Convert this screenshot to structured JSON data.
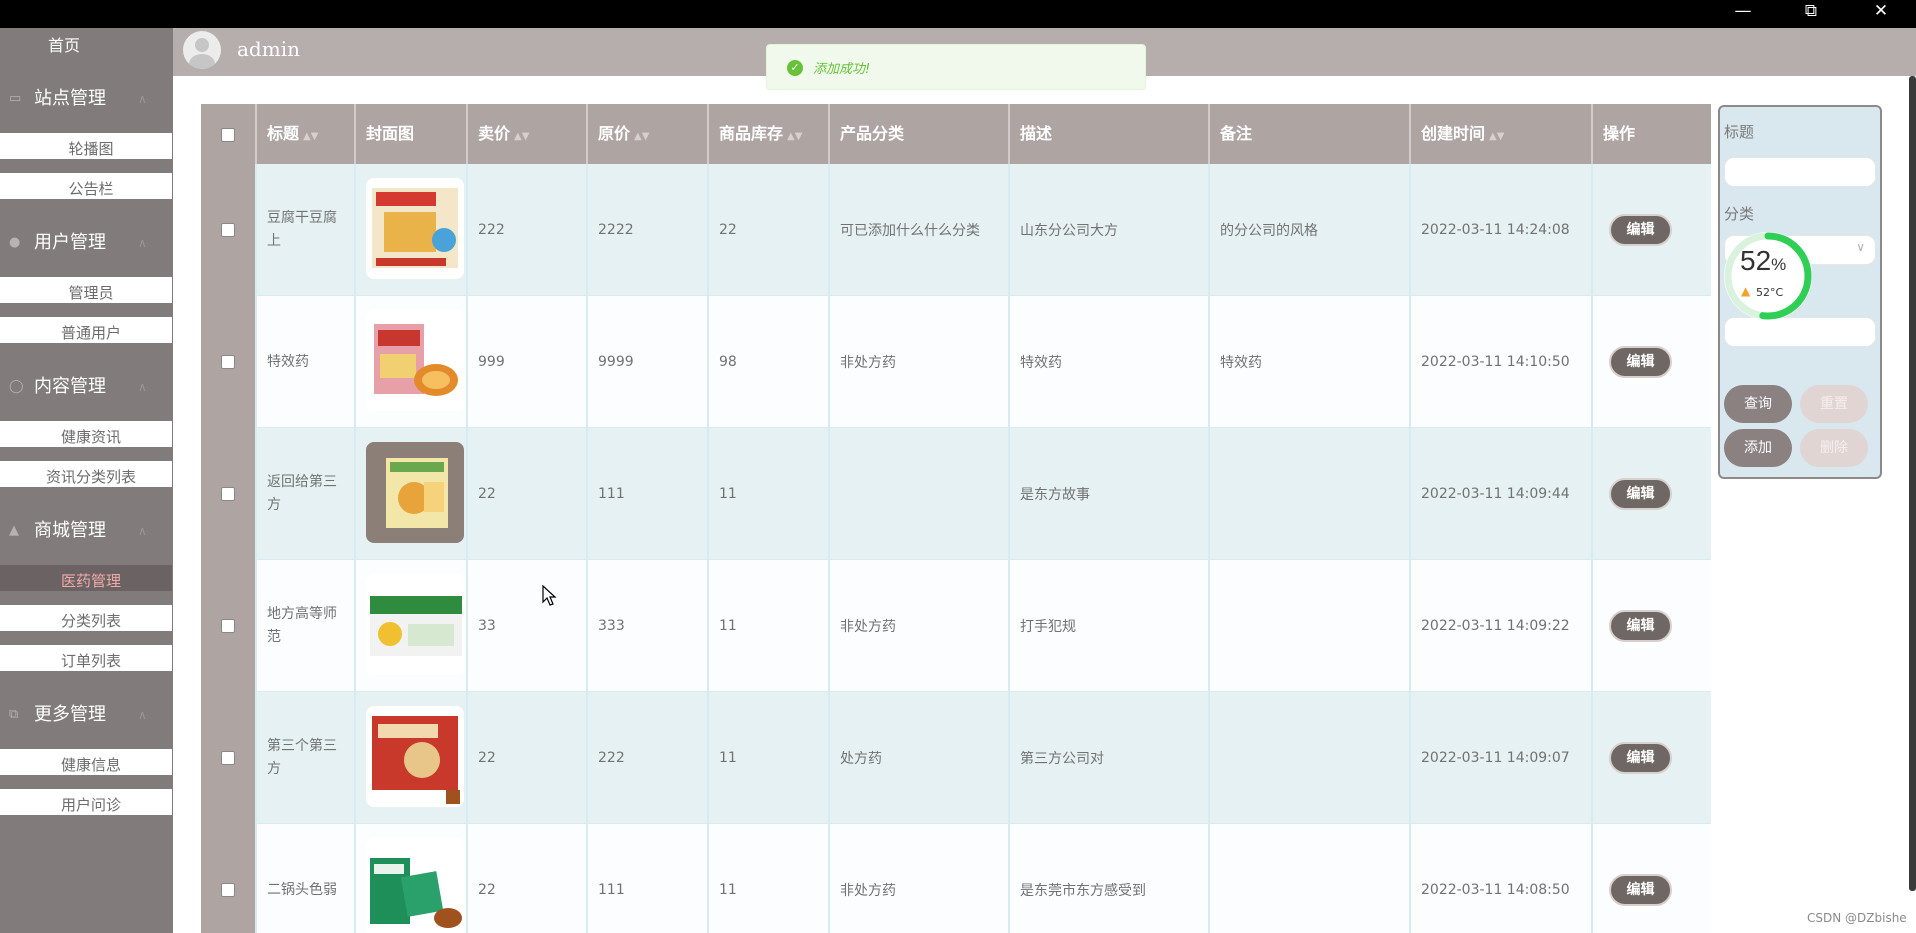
{
  "window": {
    "minimize_icon": "minimize-icon",
    "restore_icon": "restore-icon",
    "close_icon": "close-icon"
  },
  "sidebar": {
    "home": "首页",
    "groups": [
      {
        "label": "站点管理",
        "icon": "monitor-icon",
        "items": [
          "轮播图",
          "公告栏"
        ]
      },
      {
        "label": "用户管理",
        "icon": "user-icon",
        "items": [
          "管理员",
          "普通用户"
        ]
      },
      {
        "label": "内容管理",
        "icon": "content-icon",
        "items": [
          "健康资讯",
          "资讯分类列表"
        ]
      },
      {
        "label": "商城管理",
        "icon": "shop-icon",
        "items": [
          "医药管理",
          "分类列表",
          "订单列表"
        ]
      },
      {
        "label": "更多管理",
        "icon": "more-icon",
        "items": [
          "健康信息",
          "用户问诊"
        ]
      }
    ],
    "active_item": "医药管理"
  },
  "header": {
    "username": "admin"
  },
  "toast": {
    "message": "添加成功!"
  },
  "table": {
    "headers": {
      "title": "标题",
      "cover": "封面图",
      "price": "卖价",
      "original_price": "原价",
      "stock": "商品库存",
      "category": "产品分类",
      "description": "描述",
      "remark": "备注",
      "created": "创建时间",
      "actions": "操作"
    },
    "rows": [
      {
        "title": "豆腐干豆腐上",
        "price": "222",
        "original_price": "2222",
        "stock": "22",
        "category": "可已添加什么什么分类",
        "description": "山东分公司大方",
        "remark": "的分公司的风格",
        "created": "2022-03-11 14:24:08",
        "edit": "编辑"
      },
      {
        "title": "特效药",
        "price": "999",
        "original_price": "9999",
        "stock": "98",
        "category": "非处方药",
        "description": "特效药",
        "remark": "特效药",
        "created": "2022-03-11 14:10:50",
        "edit": "编辑"
      },
      {
        "title": "返回给第三方",
        "price": "22",
        "original_price": "111",
        "stock": "11",
        "category": "",
        "description": "是东方故事",
        "remark": "",
        "created": "2022-03-11 14:09:44",
        "edit": "编辑"
      },
      {
        "title": "地方高等师范",
        "price": "33",
        "original_price": "333",
        "stock": "11",
        "category": "非处方药",
        "description": "打手犯规",
        "remark": "",
        "created": "2022-03-11 14:09:22",
        "edit": "编辑"
      },
      {
        "title": "第三个第三方",
        "price": "22",
        "original_price": "222",
        "stock": "11",
        "category": "处方药",
        "description": "第三方公司对",
        "remark": "",
        "created": "2022-03-11 14:09:07",
        "edit": "编辑"
      },
      {
        "title": "二锅头色弱",
        "price": "22",
        "original_price": "111",
        "stock": "11",
        "category": "非处方药",
        "description": "是东莞市东方感受到",
        "remark": "",
        "created": "2022-03-11 14:08:50",
        "edit": "编辑"
      }
    ]
  },
  "search_panel": {
    "title_label": "标题",
    "category_label": "分类",
    "query_button": "查询",
    "reset_button": "重置",
    "add_button": "添加",
    "delete_button": "删除"
  },
  "gauge": {
    "percent": "52",
    "percent_sign": "%",
    "temperature": "52°C"
  },
  "watermark": "CSDN @DZbishe",
  "colors": {
    "sidebar": "#827b7b",
    "header": "#b6aeac",
    "table_header": "#aea5a3",
    "row_odd": "#e6f1f4",
    "edit_button": "#6f6764",
    "toast_text": "#67c23a"
  }
}
